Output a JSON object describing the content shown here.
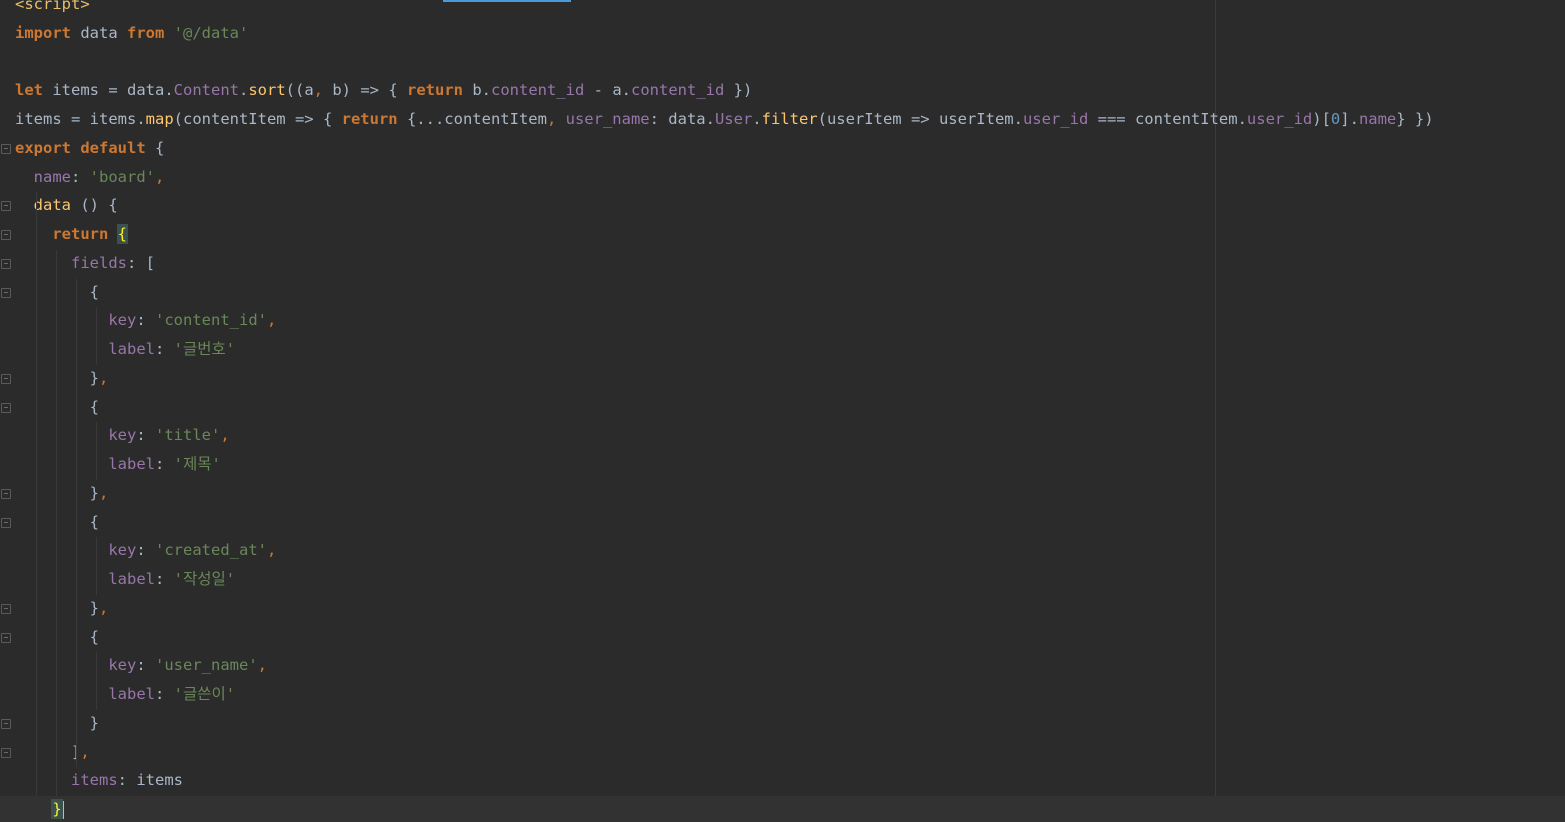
{
  "editor": {
    "lines": [
      {
        "tokens": [
          {
            "t": "<script>",
            "c": "tag"
          }
        ]
      },
      {
        "tokens": [
          {
            "t": "import",
            "c": "kw"
          },
          {
            "t": " data ",
            "c": "txt"
          },
          {
            "t": "from",
            "c": "kw"
          },
          {
            "t": " ",
            "c": "txt"
          },
          {
            "t": "'@/data'",
            "c": "str"
          }
        ]
      },
      {
        "tokens": []
      },
      {
        "tokens": [
          {
            "t": "let",
            "c": "kw"
          },
          {
            "t": " items = data.",
            "c": "txt"
          },
          {
            "t": "Content",
            "c": "prop"
          },
          {
            "t": ".",
            "c": "txt"
          },
          {
            "t": "sort",
            "c": "fn"
          },
          {
            "t": "((a",
            "c": "txt"
          },
          {
            "t": ",",
            "c": "punc"
          },
          {
            "t": " b) => { ",
            "c": "txt"
          },
          {
            "t": "return",
            "c": "kw"
          },
          {
            "t": " b.",
            "c": "txt"
          },
          {
            "t": "content_id",
            "c": "prop"
          },
          {
            "t": " - a.",
            "c": "txt"
          },
          {
            "t": "content_id",
            "c": "prop"
          },
          {
            "t": " })",
            "c": "txt"
          }
        ]
      },
      {
        "tokens": [
          {
            "t": "items = items.",
            "c": "txt"
          },
          {
            "t": "map",
            "c": "fn"
          },
          {
            "t": "(contentItem => { ",
            "c": "txt"
          },
          {
            "t": "return",
            "c": "kw"
          },
          {
            "t": " {...contentItem",
            "c": "txt"
          },
          {
            "t": ",",
            "c": "punc"
          },
          {
            "t": " ",
            "c": "txt"
          },
          {
            "t": "user_name",
            "c": "prop"
          },
          {
            "t": ": data.",
            "c": "txt"
          },
          {
            "t": "User",
            "c": "prop"
          },
          {
            "t": ".",
            "c": "txt"
          },
          {
            "t": "filter",
            "c": "fn"
          },
          {
            "t": "(userItem => userItem.",
            "c": "txt"
          },
          {
            "t": "user_id",
            "c": "prop"
          },
          {
            "t": " === contentItem.",
            "c": "txt"
          },
          {
            "t": "user_id",
            "c": "prop"
          },
          {
            "t": ")[",
            "c": "txt"
          },
          {
            "t": "0",
            "c": "num"
          },
          {
            "t": "].",
            "c": "txt"
          },
          {
            "t": "name",
            "c": "prop"
          },
          {
            "t": "} })",
            "c": "txt"
          }
        ]
      },
      {
        "tokens": [
          {
            "t": "export",
            "c": "kw"
          },
          {
            "t": " ",
            "c": "txt"
          },
          {
            "t": "default",
            "c": "kw"
          },
          {
            "t": " {",
            "c": "txt"
          }
        ]
      },
      {
        "tokens": [
          {
            "t": "  ",
            "c": "txt"
          },
          {
            "t": "name",
            "c": "prop"
          },
          {
            "t": ": ",
            "c": "txt"
          },
          {
            "t": "'board'",
            "c": "str"
          },
          {
            "t": ",",
            "c": "punc"
          }
        ]
      },
      {
        "tokens": [
          {
            "t": "  ",
            "c": "txt"
          },
          {
            "t": "data",
            "c": "fn"
          },
          {
            "t": " () {",
            "c": "txt"
          }
        ]
      },
      {
        "tokens": [
          {
            "t": "    ",
            "c": "txt"
          },
          {
            "t": "return",
            "c": "kw"
          },
          {
            "t": " ",
            "c": "txt"
          },
          {
            "t": "{",
            "c": "brace-hl"
          }
        ]
      },
      {
        "tokens": [
          {
            "t": "      ",
            "c": "txt"
          },
          {
            "t": "fields",
            "c": "prop"
          },
          {
            "t": ": [",
            "c": "txt"
          }
        ]
      },
      {
        "tokens": [
          {
            "t": "        {",
            "c": "txt"
          }
        ]
      },
      {
        "tokens": [
          {
            "t": "          ",
            "c": "txt"
          },
          {
            "t": "key",
            "c": "prop"
          },
          {
            "t": ": ",
            "c": "txt"
          },
          {
            "t": "'content_id'",
            "c": "str"
          },
          {
            "t": ",",
            "c": "punc"
          }
        ]
      },
      {
        "tokens": [
          {
            "t": "          ",
            "c": "txt"
          },
          {
            "t": "label",
            "c": "prop"
          },
          {
            "t": ": ",
            "c": "txt"
          },
          {
            "t": "'글번호'",
            "c": "str"
          }
        ]
      },
      {
        "tokens": [
          {
            "t": "        }",
            "c": "txt"
          },
          {
            "t": ",",
            "c": "punc"
          }
        ]
      },
      {
        "tokens": [
          {
            "t": "        {",
            "c": "txt"
          }
        ]
      },
      {
        "tokens": [
          {
            "t": "          ",
            "c": "txt"
          },
          {
            "t": "key",
            "c": "prop"
          },
          {
            "t": ": ",
            "c": "txt"
          },
          {
            "t": "'title'",
            "c": "str"
          },
          {
            "t": ",",
            "c": "punc"
          }
        ]
      },
      {
        "tokens": [
          {
            "t": "          ",
            "c": "txt"
          },
          {
            "t": "label",
            "c": "prop"
          },
          {
            "t": ": ",
            "c": "txt"
          },
          {
            "t": "'제목'",
            "c": "str"
          }
        ]
      },
      {
        "tokens": [
          {
            "t": "        }",
            "c": "txt"
          },
          {
            "t": ",",
            "c": "punc"
          }
        ]
      },
      {
        "tokens": [
          {
            "t": "        {",
            "c": "txt"
          }
        ]
      },
      {
        "tokens": [
          {
            "t": "          ",
            "c": "txt"
          },
          {
            "t": "key",
            "c": "prop"
          },
          {
            "t": ": ",
            "c": "txt"
          },
          {
            "t": "'created_at'",
            "c": "str"
          },
          {
            "t": ",",
            "c": "punc"
          }
        ]
      },
      {
        "tokens": [
          {
            "t": "          ",
            "c": "txt"
          },
          {
            "t": "label",
            "c": "prop"
          },
          {
            "t": ": ",
            "c": "txt"
          },
          {
            "t": "'작성일'",
            "c": "str"
          }
        ]
      },
      {
        "tokens": [
          {
            "t": "        }",
            "c": "txt"
          },
          {
            "t": ",",
            "c": "punc"
          }
        ]
      },
      {
        "tokens": [
          {
            "t": "        {",
            "c": "txt"
          }
        ]
      },
      {
        "tokens": [
          {
            "t": "          ",
            "c": "txt"
          },
          {
            "t": "key",
            "c": "prop"
          },
          {
            "t": ": ",
            "c": "txt"
          },
          {
            "t": "'user_name'",
            "c": "str"
          },
          {
            "t": ",",
            "c": "punc"
          }
        ]
      },
      {
        "tokens": [
          {
            "t": "          ",
            "c": "txt"
          },
          {
            "t": "label",
            "c": "prop"
          },
          {
            "t": ": ",
            "c": "txt"
          },
          {
            "t": "'글쓴이'",
            "c": "str"
          }
        ]
      },
      {
        "tokens": [
          {
            "t": "        }",
            "c": "txt"
          }
        ]
      },
      {
        "tokens": [
          {
            "t": "      ]",
            "c": "txt"
          },
          {
            "t": ",",
            "c": "punc"
          }
        ]
      },
      {
        "tokens": [
          {
            "t": "      ",
            "c": "txt"
          },
          {
            "t": "items",
            "c": "prop"
          },
          {
            "t": ": items",
            "c": "txt"
          }
        ]
      },
      {
        "tokens": [
          {
            "t": "    ",
            "c": "txt"
          },
          {
            "t": "}",
            "c": "brace-hl"
          }
        ],
        "current": true,
        "caret": true
      }
    ]
  },
  "colors": {
    "background": "#2b2b2b",
    "keyword": "#cc7832",
    "string": "#6a8759",
    "property": "#9876aa",
    "function": "#ffc66d",
    "number": "#6897bb",
    "text": "#a9b7c6",
    "brace_highlight": "#ffef28"
  }
}
